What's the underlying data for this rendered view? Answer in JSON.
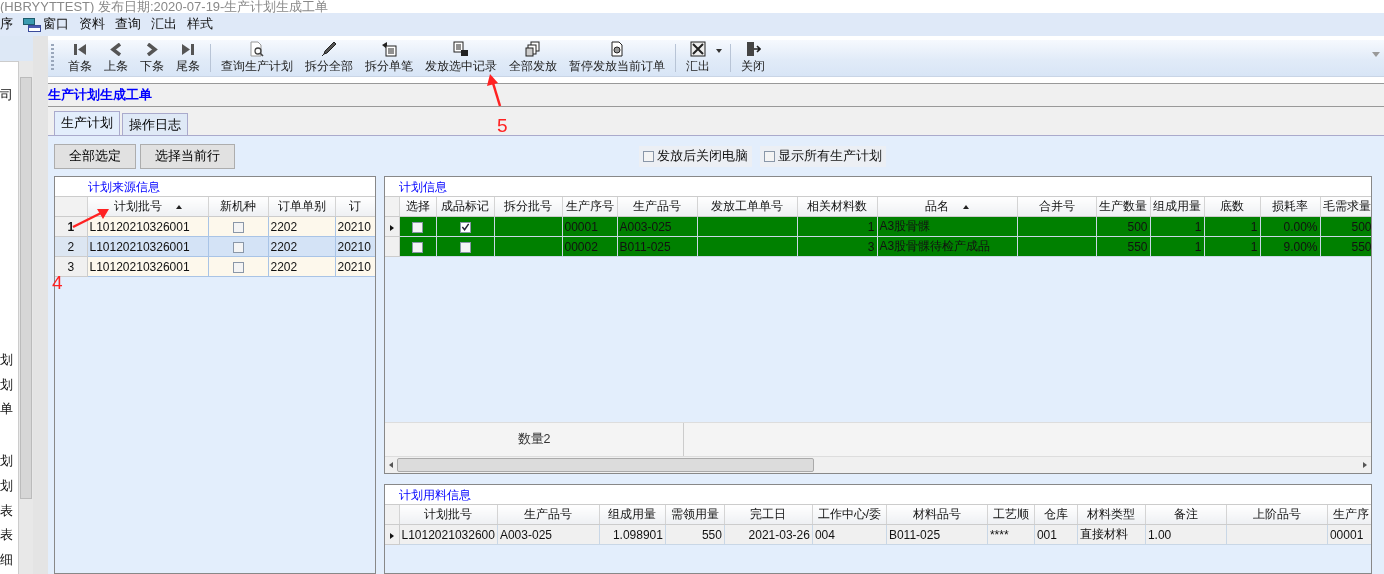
{
  "window": {
    "title": "(HBRYYTTEST) 发布日期:2020-07-19-生产计划生成工单"
  },
  "menu": [
    {
      "label": "序",
      "kind": "plain"
    },
    {
      "label": "窗口",
      "kind": "icon"
    },
    {
      "label": "资料",
      "kind": "plain"
    },
    {
      "label": "查询",
      "kind": "plain"
    },
    {
      "label": "汇出",
      "kind": "plain"
    },
    {
      "label": "样式",
      "kind": "plain"
    }
  ],
  "nav_items": [
    "司",
    "划",
    "划",
    "单",
    "划",
    "划",
    "表",
    "表",
    "细"
  ],
  "toolbar": {
    "groups": [
      [
        {
          "label": "首条"
        },
        {
          "label": "上条"
        },
        {
          "label": "下条"
        },
        {
          "label": "尾条"
        }
      ],
      [
        {
          "label": "查询生产计划"
        },
        {
          "label": "拆分全部"
        },
        {
          "label": "拆分单笔"
        },
        {
          "label": "发放选中记录"
        },
        {
          "label": "全部发放"
        },
        {
          "label": "暂停发放当前订单"
        }
      ],
      [
        {
          "label": "汇出",
          "dropdown": true
        }
      ],
      [
        {
          "label": "关闭",
          "dropdown": false
        }
      ]
    ]
  },
  "form_title": "生产计划生成工单",
  "tabs": [
    {
      "label": "生产计划",
      "selected": true
    },
    {
      "label": "操作日志",
      "selected": false
    }
  ],
  "buttons": [
    "全部选定",
    "选择当前行"
  ],
  "options": [
    {
      "label": "发放后关闭电脑",
      "checked": false
    },
    {
      "label": "显示所有生产计划",
      "checked": false
    }
  ],
  "source_grid": {
    "title": "计划来源信息",
    "columns": [
      {
        "label": "计划批号",
        "kind": "text",
        "sorted": true
      },
      {
        "label": "新机种",
        "kind": "check",
        "sorted": false
      },
      {
        "label": "订单单别",
        "kind": "text",
        "sorted": false
      },
      {
        "label": "订",
        "kind": "text",
        "sorted": false
      }
    ],
    "rows": [
      {
        "number": "1",
        "current": true,
        "selected": false,
        "cells": [
          "L10120210326001",
          {
            "checked": false
          },
          "2202",
          "20210"
        ]
      },
      {
        "number": "2",
        "current": false,
        "selected": true,
        "cells": [
          "L10120210326001",
          {
            "checked": false
          },
          "2202",
          "20210"
        ]
      },
      {
        "number": "3",
        "current": false,
        "selected": false,
        "cells": [
          "L10120210326001",
          {
            "checked": false
          },
          "2202",
          "20210"
        ]
      }
    ]
  },
  "plan_grid": {
    "title": "计划信息",
    "columns": [
      {
        "label": "选择",
        "kind": "check",
        "sorted": false
      },
      {
        "label": "成品标记",
        "kind": "check",
        "sorted": false
      },
      {
        "label": "拆分批号",
        "kind": "text",
        "sorted": false
      },
      {
        "label": "生产序号",
        "kind": "text",
        "sorted": false
      },
      {
        "label": "生产品号",
        "kind": "text",
        "sorted": false
      },
      {
        "label": "发放工单单号",
        "kind": "text",
        "sorted": false
      },
      {
        "label": "相关材料数",
        "kind": "number",
        "sorted": false
      },
      {
        "label": "品名",
        "kind": "text",
        "sorted": true
      },
      {
        "label": "合并号",
        "kind": "text",
        "sorted": false
      },
      {
        "label": "生产数量",
        "kind": "number",
        "sorted": false
      },
      {
        "label": "组成用量",
        "kind": "number",
        "sorted": false
      },
      {
        "label": "底数",
        "kind": "number",
        "sorted": false
      },
      {
        "label": "损耗率",
        "kind": "number",
        "sorted": false
      },
      {
        "label": "毛需求量",
        "kind": "number",
        "sorted": false
      }
    ],
    "rows": [
      {
        "current": true,
        "cells": [
          {
            "checked": false
          },
          {
            "checked": true
          },
          "",
          "00001",
          "A003-025",
          "",
          "1",
          "A3股骨髁",
          "",
          "500",
          "1",
          "1",
          "0.00%",
          "500"
        ]
      },
      {
        "current": false,
        "cells": [
          {
            "checked": false
          },
          {
            "checked": false
          },
          "",
          "00002",
          "B011-025",
          "",
          "3",
          "A3股骨髁待检产成品",
          "",
          "550",
          "1",
          "1",
          "9.00%",
          "550"
        ]
      }
    ],
    "footer": "数量2"
  },
  "material_grid": {
    "title": "计划用料信息",
    "columns": [
      {
        "label": "计划批号",
        "kind": "text",
        "sorted": false
      },
      {
        "label": "生产品号",
        "kind": "text",
        "sorted": false
      },
      {
        "label": "组成用量",
        "kind": "number",
        "sorted": false
      },
      {
        "label": "需领用量",
        "kind": "number",
        "sorted": false
      },
      {
        "label": "完工日",
        "kind": "number",
        "sorted": false
      },
      {
        "label": "工作中心/委",
        "kind": "text",
        "sorted": false
      },
      {
        "label": "材料品号",
        "kind": "text",
        "sorted": false
      },
      {
        "label": "工艺顺",
        "kind": "text",
        "sorted": false
      },
      {
        "label": "仓库",
        "kind": "text",
        "sorted": false
      },
      {
        "label": "材料类型",
        "kind": "text",
        "sorted": false
      },
      {
        "label": "备注",
        "kind": "text",
        "sorted": false
      },
      {
        "label": "上阶品号",
        "kind": "text",
        "sorted": false
      },
      {
        "label": "生产序",
        "kind": "text",
        "sorted": false
      }
    ],
    "rows": [
      {
        "current": true,
        "cells": [
          "L1012021032600",
          "A003-025",
          "1.098901",
          "550",
          "2021-03-26",
          "004",
          "B011-025",
          "****",
          "001",
          "直接材料",
          "1.00",
          "",
          "00001"
        ]
      }
    ]
  },
  "annotations": [
    {
      "label": "4"
    },
    {
      "label": "5"
    }
  ]
}
